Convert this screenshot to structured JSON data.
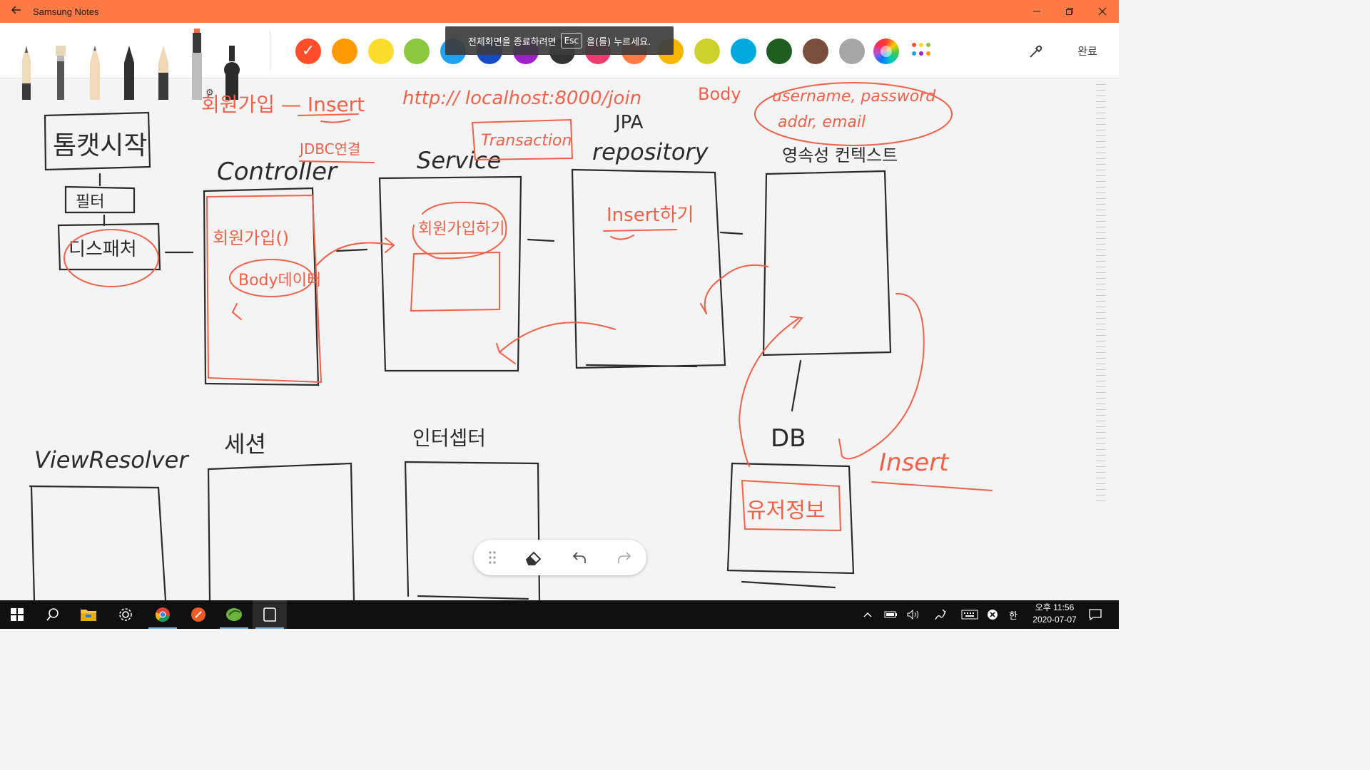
{
  "window": {
    "title": "Samsung Notes",
    "back_icon": "back-arrow-icon",
    "controls": [
      "minimize-icon",
      "restore-icon",
      "close-icon"
    ]
  },
  "toolbar": {
    "pens": [
      "fountain-pen-icon",
      "brush-pen-icon",
      "pencil-icon",
      "pen-icon",
      "marker-icon",
      "highlighter-settings-icon",
      "stamp-pen-icon"
    ],
    "swatches": [
      "#ff4e2b",
      "#ff9a00",
      "#fbdb2c",
      "#8dc63f",
      "#1ea1f1",
      "#1749c4",
      "#a020c8",
      "#333333",
      "#ef3b6e",
      "#ff7a45",
      "#f5b700",
      "#cfd12a",
      "#00a8e0",
      "#1f5c1f",
      "#7a4e3a",
      "#a6a6a6"
    ],
    "selected_swatch_index": 0,
    "done_label": "완료"
  },
  "fullscreen_toast": {
    "before": "전체화면을 종료하려면",
    "key": "Esc",
    "after": "을(를) 누르세요."
  },
  "note": {
    "ink_color": "#f0614a",
    "pen_color": "#2b2b2b",
    "labels": {
      "filter_start": "톰캣시작",
      "filter": "필터",
      "dispatcher": "디스패처",
      "controller": "Controller",
      "controller_note1": "회원가입()",
      "controller_note2": "Body데이터",
      "jdbc": "JDBC연결",
      "service": "Service",
      "transaction": "Transaction",
      "service_note": "회원가입하기",
      "jpa": "JPA",
      "repository": "repository",
      "repository_note": "Insert하기",
      "persistence": "영속성 컨텍스트",
      "signup": "회원가입 — Insert",
      "url": "http:// localhost:8000/join",
      "body_label": "Body",
      "body_fields1": "username, password",
      "body_fields2": "addr, email",
      "db": "DB",
      "db_note": "유저정보",
      "insert": "Insert",
      "view_resolver": "ViewResolver",
      "session": "세션",
      "interceptor": "인터셉터"
    }
  },
  "float_toolbar": [
    "drag-handle-icon",
    "eraser-icon",
    "undo-icon",
    "redo-icon"
  ],
  "taskbar": {
    "apps": [
      "windows-start-icon",
      "search-icon",
      "file-explorer-icon",
      "settings-gear-icon",
      "chrome-icon",
      "postman-icon",
      "spring-tools-icon",
      "samsung-notes-icon"
    ],
    "ime": "한",
    "time": "오후 11:56",
    "date": "2020-07-07"
  }
}
